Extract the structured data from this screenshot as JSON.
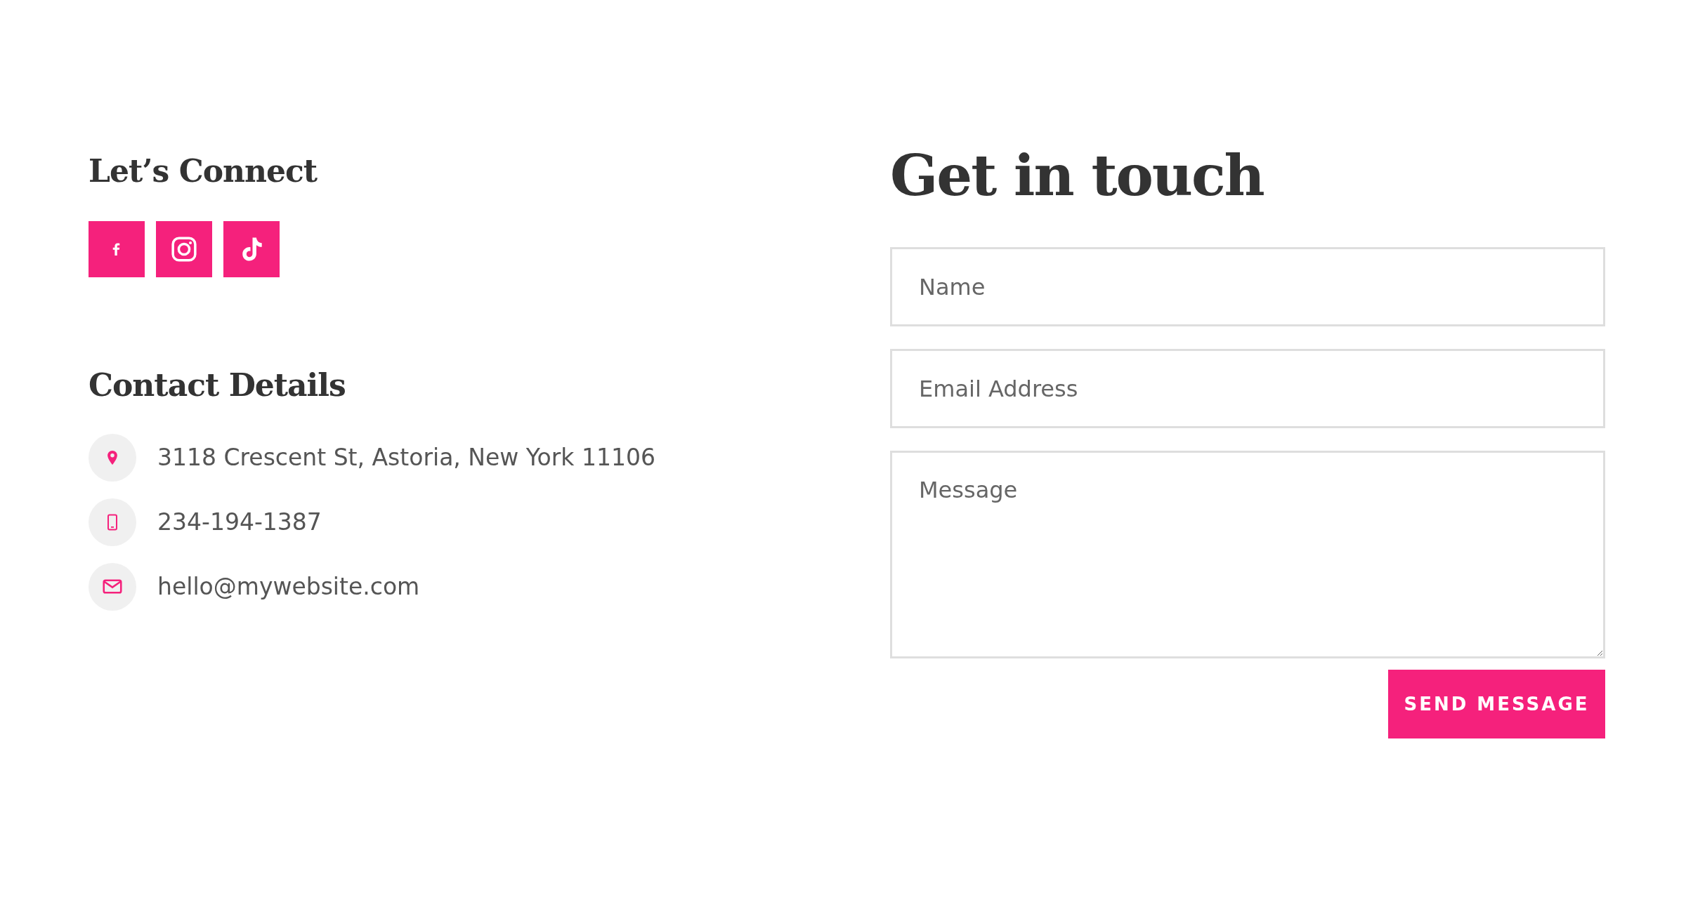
{
  "connect": {
    "heading": "Let’s Connect",
    "social": [
      {
        "kind": "facebook"
      },
      {
        "kind": "instagram"
      },
      {
        "kind": "tiktok"
      }
    ]
  },
  "contact": {
    "heading": "Contact Details",
    "items": [
      {
        "kind": "location",
        "text": "3118 Crescent St, Astoria, New York 11106"
      },
      {
        "kind": "phone",
        "text": "234-194-1387"
      },
      {
        "kind": "email",
        "text": "hello@mywebsite.com"
      }
    ]
  },
  "form": {
    "heading": "Get in touch",
    "fields": [
      {
        "kind": "input",
        "placeholder": "Name"
      },
      {
        "kind": "input",
        "placeholder": "Email Address"
      },
      {
        "kind": "textarea",
        "placeholder": "Message"
      }
    ],
    "button": "SEND MESSAGE"
  }
}
